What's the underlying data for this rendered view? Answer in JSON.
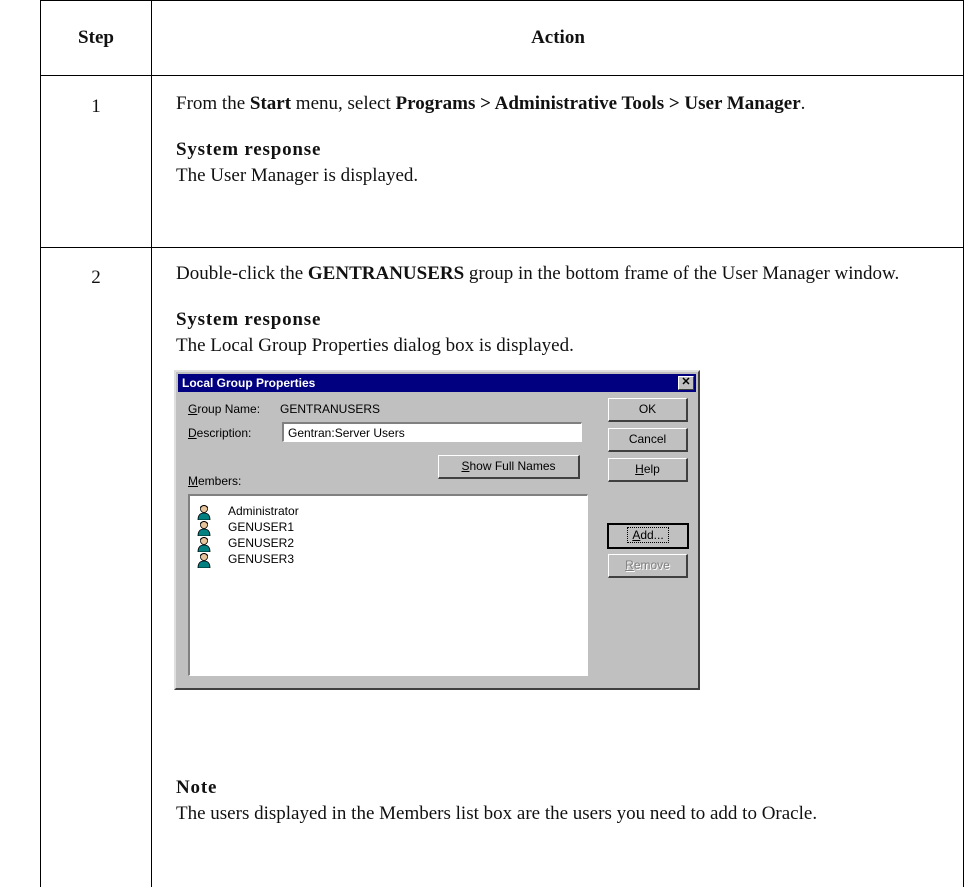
{
  "table": {
    "header": {
      "step": "Step",
      "action": "Action"
    },
    "rows": [
      {
        "step": "1",
        "action_parts": {
          "a": "From the ",
          "b": "Start",
          "c": " menu, select ",
          "d": "Programs > Administrative Tools > User Manager",
          "e": "."
        },
        "response_heading": "System response",
        "response_text": "The User Manager is displayed."
      },
      {
        "step": "2",
        "action_parts": {
          "a": "Double-click the ",
          "b": "GENTRANUSERS",
          "c": " group in the bottom frame of the User Manager window."
        },
        "response_heading": "System response",
        "response_text": "The Local Group Properties dialog box is displayed.",
        "note_heading": "Note",
        "note_text": "The users displayed in the Members list box are the users you need to add to Oracle."
      }
    ]
  },
  "dialog": {
    "title": "Local Group Properties",
    "close_glyph": "✕",
    "group_name_label_accel": "G",
    "group_name_label_rest": "roup Name:",
    "group_name_value": "GENTRANUSERS",
    "description_label_accel": "D",
    "description_label_rest": "escription:",
    "description_value": "Gentran:Server Users",
    "show_full_names_accel": "S",
    "show_full_names_rest": "how Full Names",
    "members_label_accel": "M",
    "members_label_rest": "embers:",
    "members": [
      "Administrator",
      "GENUSER1",
      "GENUSER2",
      "GENUSER3"
    ],
    "buttons": {
      "ok": "OK",
      "cancel": "Cancel",
      "help_accel": "H",
      "help_rest": "elp",
      "add_accel": "A",
      "add_rest": "dd...",
      "remove_accel": "R",
      "remove_rest": "emove"
    }
  }
}
